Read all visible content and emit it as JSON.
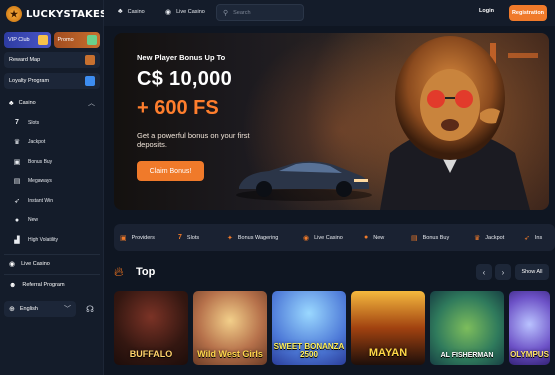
{
  "brand": {
    "name": "LUCKYSTAKES"
  },
  "sidebar": {
    "promo": [
      {
        "label": "VIP Club"
      },
      {
        "label": "Promo"
      }
    ],
    "reward_map": "Reward Map",
    "loyalty": "Loyalty Program",
    "category_header": "Casino",
    "categories": [
      {
        "label": "Slots",
        "icon": "7"
      },
      {
        "label": "Jackpot",
        "icon": "crown"
      },
      {
        "label": "Bonus Buy",
        "icon": "bag"
      },
      {
        "label": "Megaways",
        "icon": "ladder"
      },
      {
        "label": "Instant Win",
        "icon": "rocket"
      },
      {
        "label": "New",
        "icon": "new"
      },
      {
        "label": "High Volatility",
        "icon": "chart"
      }
    ],
    "live_casino": "Live Casino",
    "referral": "Referral Program",
    "language": "English"
  },
  "topbar": {
    "nav": [
      {
        "label": "Casino"
      },
      {
        "label": "Live Casino"
      }
    ],
    "search_placeholder": "Search",
    "login": "Login",
    "register": "Registration"
  },
  "hero": {
    "subtitle": "New Player Bonus Up To",
    "amount": "C$ 10,000",
    "free_spins": "+ 600 FS",
    "description": "Get a powerful bonus on your first deposits.",
    "cta": "Claim Bonus!"
  },
  "strip": [
    {
      "label": "Providers"
    },
    {
      "label": "Slots"
    },
    {
      "label": "Bonus Wagering"
    },
    {
      "label": "Live Casino"
    },
    {
      "label": "New"
    },
    {
      "label": "Bonus Buy"
    },
    {
      "label": "Jackpot"
    },
    {
      "label": "Ins"
    }
  ],
  "top_section": {
    "title": "Top",
    "show_all": "Show All",
    "games": [
      {
        "title": "BUFFALO"
      },
      {
        "title": "Wild West Girls"
      },
      {
        "title": "SWEET BONANZA 2500"
      },
      {
        "title": "MAYAN"
      },
      {
        "title": "AL FISHERMAN"
      },
      {
        "title": "OLYMPUS"
      }
    ]
  },
  "colors": {
    "accent": "#f07a2a",
    "background": "#0f1622",
    "panel": "#141c2a"
  }
}
